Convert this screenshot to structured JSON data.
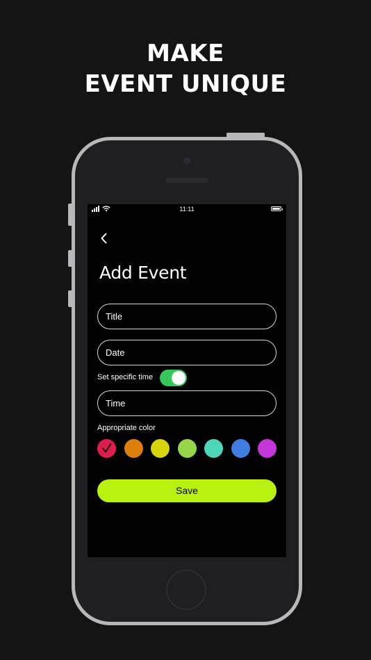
{
  "headline": {
    "line1": "MAKE",
    "line2": "EVENT UNIQUE"
  },
  "status_bar": {
    "time": "11:11"
  },
  "screen": {
    "title": "Add Event",
    "back_icon": "chevron-left-icon",
    "fields": {
      "title_placeholder": "Title",
      "date_placeholder": "Date",
      "time_placeholder": "Time"
    },
    "specific_time": {
      "label": "Set specific time",
      "on": true,
      "accent": "#34c759"
    },
    "color_picker": {
      "label": "Appropriate color",
      "selected_index": 0,
      "colors": [
        "#dc1d4d",
        "#dd7f0b",
        "#d8d40e",
        "#97d54a",
        "#4dd7b8",
        "#3d7ee0",
        "#c436d8"
      ]
    },
    "save_label": "Save",
    "save_color": "#b8f10d"
  }
}
